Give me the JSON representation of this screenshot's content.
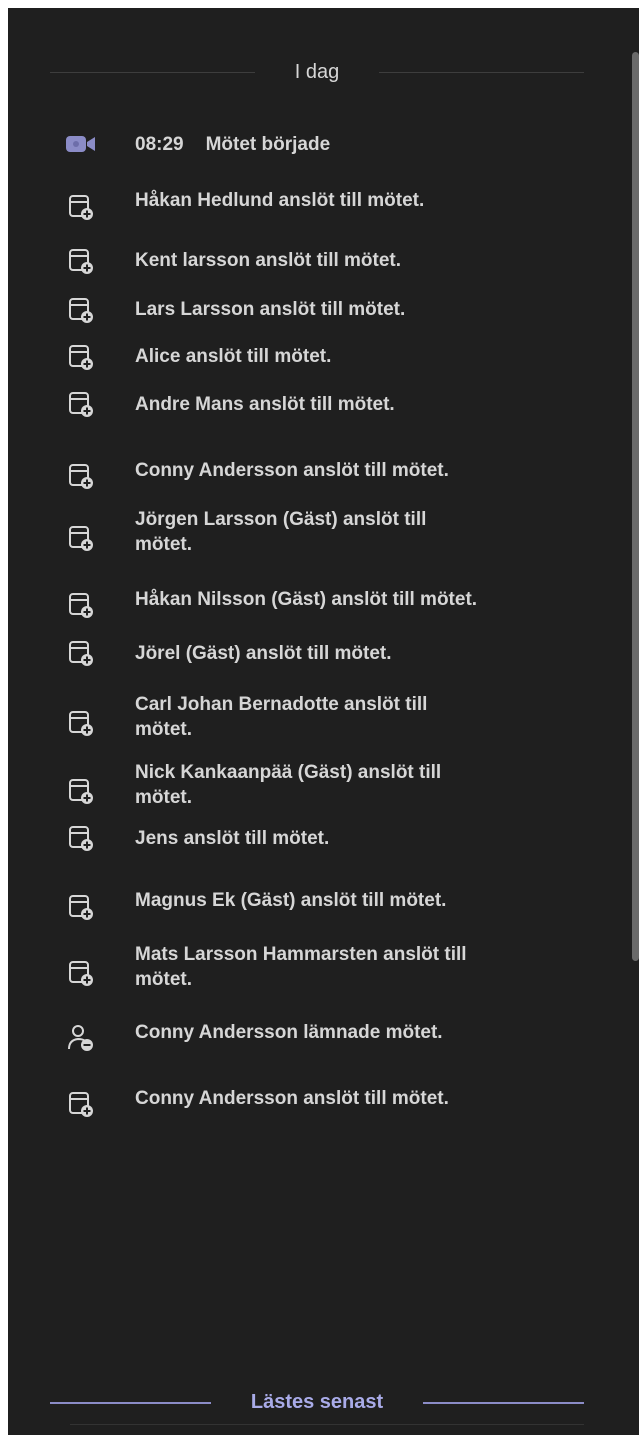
{
  "header": {
    "today_label": "I dag"
  },
  "events": [
    {
      "time": "08:29",
      "text": "Mötet började",
      "icon": "video-call-icon"
    },
    {
      "time": "",
      "text": "Håkan Hedlund anslöt till mötet.",
      "icon": "calendar-add-icon"
    },
    {
      "time": "",
      "text": "Kent larsson anslöt till mötet.",
      "icon": "calendar-add-icon"
    },
    {
      "time": "",
      "text": "Lars Larsson anslöt till mötet.",
      "icon": "calendar-add-icon"
    },
    {
      "time": "",
      "text": "Alice anslöt till mötet.",
      "icon": "calendar-add-icon"
    },
    {
      "time": "",
      "text": "Andre Mans anslöt till mötet.",
      "icon": "calendar-add-icon"
    },
    {
      "time": "",
      "text": "Conny Andersson anslöt till mötet.",
      "icon": "calendar-add-icon"
    },
    {
      "time": "",
      "text": "Jörgen Larsson (Gäst) anslöt till mötet.",
      "icon": "calendar-add-icon"
    },
    {
      "time": "",
      "text": "Håkan Nilsson (Gäst) anslöt till mötet.",
      "icon": "calendar-add-icon"
    },
    {
      "time": "",
      "text": "Jörel (Gäst) anslöt till mötet.",
      "icon": "calendar-add-icon"
    },
    {
      "time": "",
      "text": "Carl Johan Bernadotte anslöt till mötet.",
      "icon": "calendar-add-icon"
    },
    {
      "time": "",
      "text": "Nick Kankaanpää (Gäst) anslöt till mötet.",
      "icon": "calendar-add-icon"
    },
    {
      "time": "",
      "text": "Jens anslöt till mötet.",
      "icon": "calendar-add-icon"
    },
    {
      "time": "",
      "text": "Magnus Ek (Gäst) anslöt till mötet.",
      "icon": "calendar-add-icon"
    },
    {
      "time": "",
      "text": "Mats Larsson Hammarsten anslöt till mötet.",
      "icon": "calendar-add-icon"
    },
    {
      "time": "",
      "text": "Conny Andersson lämnade mötet.",
      "icon": "person-leave-icon"
    },
    {
      "time": "",
      "text": "Conny Andersson anslöt till mötet.",
      "icon": "calendar-add-icon"
    }
  ],
  "last_read": {
    "label": "Lästes senast"
  },
  "colors": {
    "background": "#1f1f1f",
    "text": "#d6d6d6",
    "accent": "#a9abe8"
  }
}
